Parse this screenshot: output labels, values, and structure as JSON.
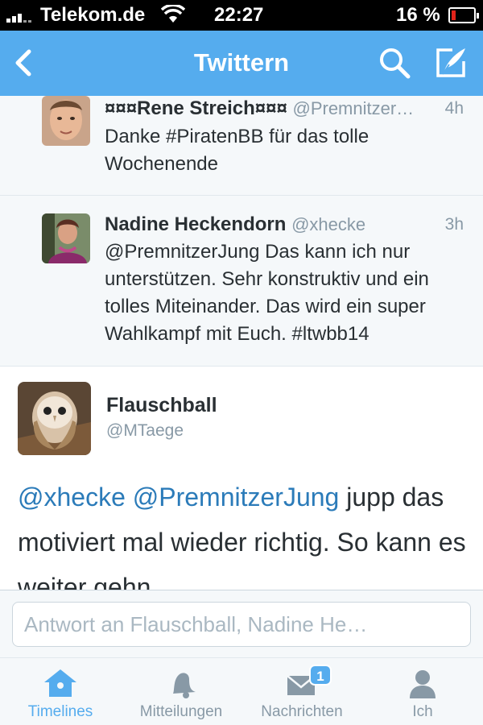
{
  "status_bar": {
    "carrier": "Telekom.de",
    "time": "22:27",
    "battery": "16 %"
  },
  "nav": {
    "title": "Twittern"
  },
  "tweets": [
    {
      "name": "¤¤¤Rene Streich¤¤¤",
      "handle": "@Premnitzer…",
      "time": "4h",
      "text": "Danke #PiratenBB für das tolle Wochenende"
    },
    {
      "name": "Nadine Heckendorn",
      "handle": "@xhecke",
      "time": "3h",
      "text": "@PremnitzerJung Das kann ich nur unterstützen. Sehr konstruktiv und ein tolles Miteinander. Das wird ein super Wahlkampf mit Euch. #ltwbb14"
    }
  ],
  "focused_tweet": {
    "name": "Flauschball",
    "handle": "@MTaege",
    "mention_1": "@xhecke",
    "mention_2": "@PremnitzerJung",
    "text_rest": " jupp das motiviert mal wieder richtig. So kann es weiter gehn."
  },
  "reply": {
    "placeholder": "Antwort an Flauschball, Nadine He…"
  },
  "tabs": [
    {
      "label": "Timelines",
      "icon": "home-icon",
      "active": true
    },
    {
      "label": "Mitteilungen",
      "icon": "bell-icon",
      "active": false
    },
    {
      "label": "Nachrichten",
      "icon": "envelope-icon",
      "active": false,
      "badge": "1"
    },
    {
      "label": "Ich",
      "icon": "person-icon",
      "active": false
    }
  ],
  "colors": {
    "accent": "#55acee",
    "link": "#2b7bb9",
    "battery_low": "#e2231a"
  }
}
